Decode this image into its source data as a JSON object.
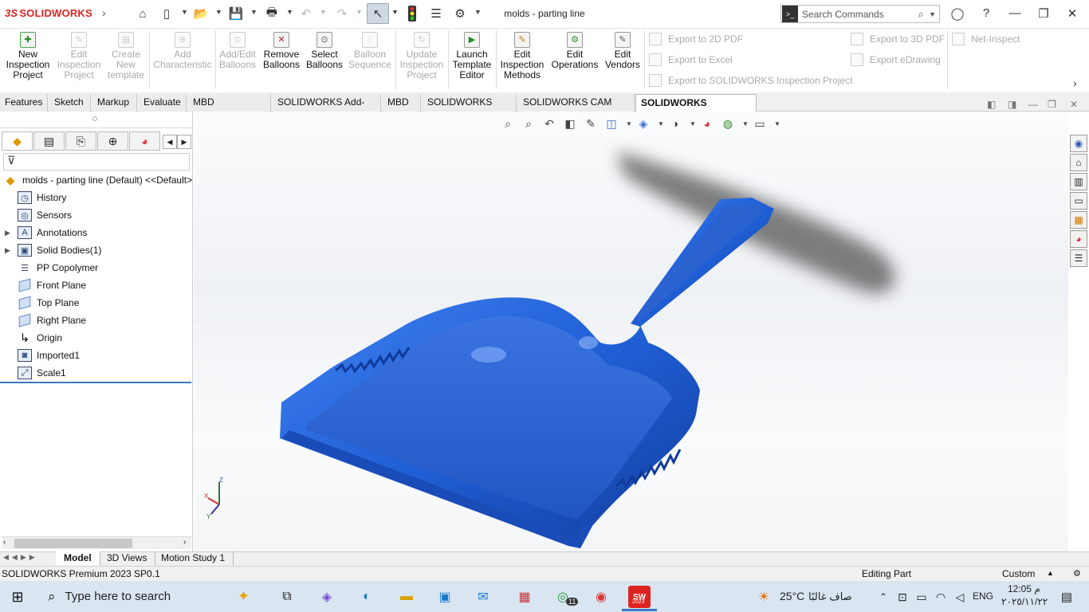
{
  "app": {
    "logo_ds": "3S",
    "logo_name": "SOLIDWORKS",
    "window_title": "molds - parting line"
  },
  "quick_access": {
    "icons": [
      "home-icon",
      "new-document-icon",
      "open-icon",
      "save-icon",
      "print-icon",
      "undo-icon",
      "redo-icon",
      "select-icon",
      "traffic-light-icon",
      "file-properties-icon",
      "options-gear-icon"
    ]
  },
  "search": {
    "placeholder": "Search Commands"
  },
  "ribbon": {
    "buttons": [
      {
        "label1": "New",
        "label2": "Inspection",
        "label3": "Project",
        "enabled": true
      },
      {
        "label1": "Edit",
        "label2": "Inspection",
        "label3": "Project",
        "enabled": false
      },
      {
        "label1": "Create",
        "label2": "New",
        "label3": "template",
        "enabled": false
      },
      {
        "label1": "Add",
        "label2": "Characteristic",
        "label3": "",
        "enabled": false
      },
      {
        "label1": "Add/Edit",
        "label2": "Balloons",
        "label3": "",
        "enabled": false
      },
      {
        "label1": "Remove",
        "label2": "Balloons",
        "label3": "",
        "enabled": true
      },
      {
        "label1": "Select",
        "label2": "Balloons",
        "label3": "",
        "enabled": true
      },
      {
        "label1": "Balloon",
        "label2": "Sequence",
        "label3": "",
        "enabled": false
      },
      {
        "label1": "Update",
        "label2": "Inspection",
        "label3": "Project",
        "enabled": false
      },
      {
        "label1": "Launch",
        "label2": "Template",
        "label3": "Editor",
        "enabled": true
      },
      {
        "label1": "Edit",
        "label2": "Inspection",
        "label3": "Methods",
        "enabled": true
      },
      {
        "label1": "Edit",
        "label2": "Operations",
        "label3": "",
        "enabled": true
      },
      {
        "label1": "Edit",
        "label2": "Vendors",
        "label3": "",
        "enabled": true
      }
    ],
    "exports": {
      "pdf2d": "Export to 2D PDF",
      "excel": "Export to Excel",
      "sw_project": "Export to SOLIDWORKS Inspection Project",
      "pdf3d": "Export to 3D PDF",
      "edrawing": "Export eDrawing",
      "net_inspect": "Net-Inspect"
    }
  },
  "tabs": [
    "Features",
    "Sketch",
    "Markup",
    "Evaluate",
    "MBD Dimensions",
    "SOLIDWORKS Add-Ins",
    "MBD",
    "SOLIDWORKS CAM",
    "SOLIDWORKS CAM TBM",
    "SOLIDWORKS Inspection"
  ],
  "tree": {
    "root": "molds - parting line (Default) <<Default>",
    "items": [
      {
        "label": "History",
        "icon": "history-icon",
        "expandable": false
      },
      {
        "label": "Sensors",
        "icon": "sensors-icon",
        "expandable": false
      },
      {
        "label": "Annotations",
        "icon": "annotations-icon",
        "expandable": true
      },
      {
        "label": "Solid Bodies(1)",
        "icon": "solid-bodies-icon",
        "expandable": true
      },
      {
        "label": "PP Copolymer",
        "icon": "material-icon",
        "expandable": false
      },
      {
        "label": "Front Plane",
        "icon": "plane-icon",
        "expandable": false
      },
      {
        "label": "Top Plane",
        "icon": "plane-icon",
        "expandable": false
      },
      {
        "label": "Right Plane",
        "icon": "plane-icon",
        "expandable": false
      },
      {
        "label": "Origin",
        "icon": "origin-icon",
        "expandable": false
      },
      {
        "label": "Imported1",
        "icon": "imported-icon",
        "expandable": false
      },
      {
        "label": "Scale1",
        "icon": "scale-icon",
        "expandable": false
      }
    ]
  },
  "triad": {
    "z": "Z",
    "x": "X",
    "y": "Y"
  },
  "bottom_tabs": [
    "Model",
    "3D Views",
    "Motion Study 1"
  ],
  "status": {
    "left": "SOLIDWORKS Premium 2023 SP0.1",
    "mode": "Editing Part",
    "units": "Custom"
  },
  "taskbar": {
    "search_placeholder": "Type here to search",
    "weather_temp": "25°C",
    "weather_desc": "صاف غالبًا",
    "language": "ENG",
    "time": "12:05 م",
    "date": "٢٠٢٥/١١/٢٢",
    "whatsapp_badge": "11",
    "sw_label": "2023"
  },
  "colors": {
    "part_blue": "#1f5fd6",
    "accent": "#d22222"
  }
}
